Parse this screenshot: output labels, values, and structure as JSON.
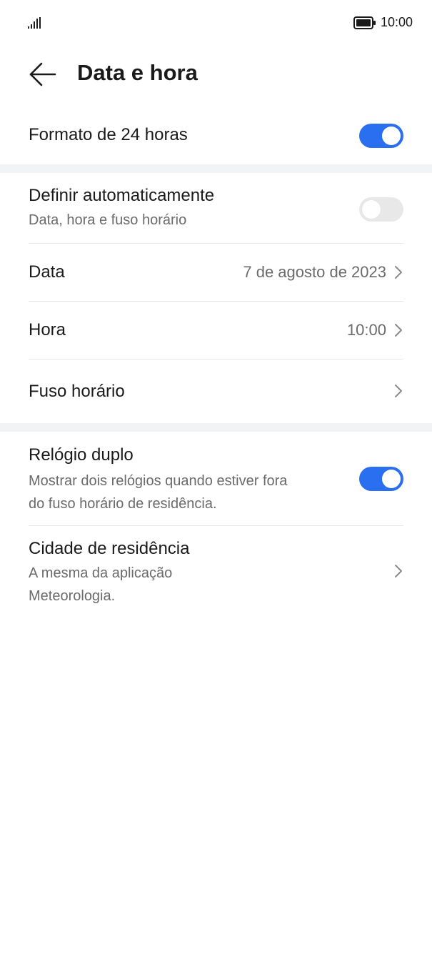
{
  "status_bar": {
    "time": "10:00",
    "signal_icon": "signal-icon",
    "battery_icon": "battery-icon"
  },
  "header": {
    "back_icon": "arrow-left-icon",
    "title": "Data e hora"
  },
  "settings": {
    "format24": {
      "title": "Formato de 24 horas",
      "enabled": true
    },
    "auto": {
      "title": "Definir automaticamente",
      "subtitle": "Data, hora e fuso horário",
      "enabled": false
    },
    "date": {
      "title": "Data",
      "value": "7 de agosto de 2023"
    },
    "time": {
      "title": "Hora",
      "value": "10:00"
    },
    "timezone": {
      "title": "Fuso horário"
    },
    "dual_clock": {
      "title": "Relógio duplo",
      "subtitle_line1": "Mostrar dois relógios quando estiver fora",
      "subtitle_line2": "do fuso horário de residência.",
      "enabled": true
    },
    "home_city": {
      "title": "Cidade de residência",
      "subtitle_line1": "A mesma da aplicação",
      "subtitle_line2": "Meteorologia."
    }
  },
  "colors": {
    "accent": "#2a6ff0",
    "toggle_off": "#e8e8e8",
    "secondary_text": "#6b6b6b",
    "section_gap": "#f1f3f5"
  }
}
